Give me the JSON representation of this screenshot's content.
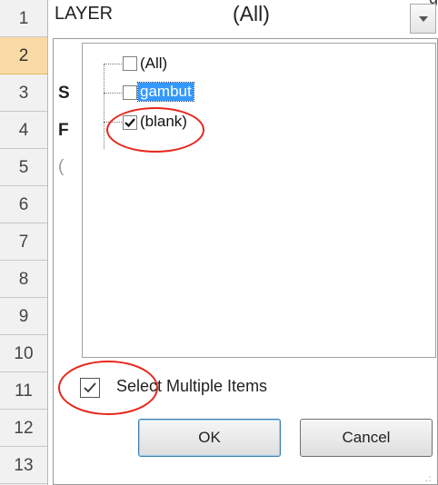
{
  "corner_glyph": "g",
  "row_headers": [
    "1",
    "2",
    "3",
    "4",
    "5",
    "6",
    "7",
    "8",
    "9",
    "10",
    "11",
    "12",
    "13"
  ],
  "selected_row": "2",
  "cells": {
    "field_name": "LAYER",
    "field_value": "(All)",
    "row3_partial": "S",
    "row4_partial": "F",
    "row5_partial": "("
  },
  "filter_list": {
    "items": [
      {
        "label": "(All)",
        "checked": false,
        "highlighted": false
      },
      {
        "label": "gambut",
        "checked": false,
        "highlighted": true
      },
      {
        "label": "(blank)",
        "checked": true,
        "highlighted": false
      }
    ]
  },
  "options": {
    "select_multiple_label": "Select Multiple Items",
    "select_multiple_checked": true
  },
  "buttons": {
    "ok": "OK",
    "cancel": "Cancel"
  },
  "colors": {
    "annotation": "#e8261c",
    "selection": "#3399ff",
    "selected_row_header": "#f9d9a5"
  },
  "icons": {
    "dropdown": "chevron-down-icon",
    "checkbox_checked": "checkmark-icon",
    "resize": "resize-grip-icon"
  }
}
